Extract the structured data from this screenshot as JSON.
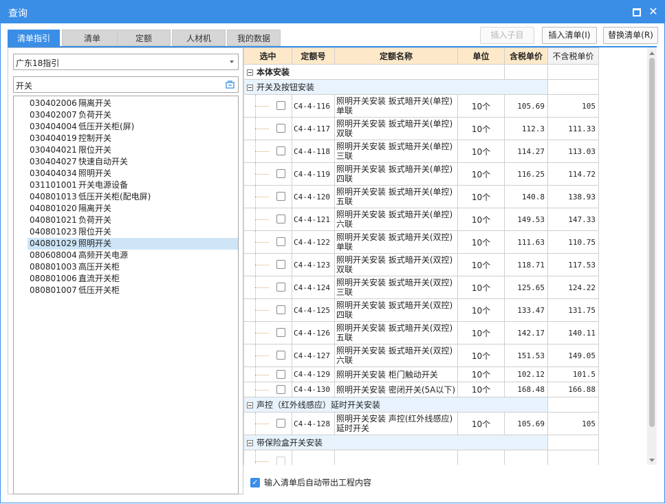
{
  "window": {
    "title": "查询"
  },
  "tabs": [
    {
      "label": "清单指引",
      "active": true
    },
    {
      "label": "清单",
      "active": false
    },
    {
      "label": "定额",
      "active": false
    },
    {
      "label": "人材机",
      "active": false
    },
    {
      "label": "我的数据",
      "active": false
    }
  ],
  "toolbar": {
    "insert_child_label": "插入子目",
    "insert_list_label": "插入清单(I)",
    "replace_list_label": "替换清单(R)"
  },
  "left": {
    "guide_select": "广东18指引",
    "search_value": "开关",
    "items": [
      {
        "code": "030402006",
        "name": "隔离开关"
      },
      {
        "code": "030402007",
        "name": "负荷开关"
      },
      {
        "code": "030404004",
        "name": "低压开关柜(屏)"
      },
      {
        "code": "030404019",
        "name": "控制开关"
      },
      {
        "code": "030404021",
        "name": "限位开关"
      },
      {
        "code": "030404027",
        "name": "快速自动开关"
      },
      {
        "code": "030404034",
        "name": "照明开关"
      },
      {
        "code": "031101001",
        "name": "开关电源设备"
      },
      {
        "code": "040801013",
        "name": "低压开关柜(配电屏)"
      },
      {
        "code": "040801020",
        "name": "隔离开关"
      },
      {
        "code": "040801021",
        "name": "负荷开关"
      },
      {
        "code": "040801023",
        "name": "限位开关"
      },
      {
        "code": "040801029",
        "name": "照明开关",
        "selected": true
      },
      {
        "code": "080608004",
        "name": "高频开关电源"
      },
      {
        "code": "080801003",
        "name": "高压开关柜"
      },
      {
        "code": "080801006",
        "name": "直流开关柜"
      },
      {
        "code": "080801007",
        "name": "低压开关柜"
      }
    ]
  },
  "grid": {
    "headers": [
      "选中",
      "定额号",
      "定额名称",
      "单位",
      "含税单价",
      "不含税单价"
    ],
    "root_group": "本体安装",
    "groups": [
      {
        "title": "开关及按钮安装",
        "rows": [
          {
            "code": "C4-4-116",
            "name": "照明开关安装 扳式暗开关(单控)单联",
            "unit": "10个",
            "price_tax": "105.69",
            "price_notax": "105"
          },
          {
            "code": "C4-4-117",
            "name": "照明开关安装 扳式暗开关(单控)双联",
            "unit": "10个",
            "price_tax": "112.3",
            "price_notax": "111.33"
          },
          {
            "code": "C4-4-118",
            "name": "照明开关安装 扳式暗开关(单控)三联",
            "unit": "10个",
            "price_tax": "114.27",
            "price_notax": "113.03"
          },
          {
            "code": "C4-4-119",
            "name": "照明开关安装 扳式暗开关(单控)四联",
            "unit": "10个",
            "price_tax": "116.25",
            "price_notax": "114.72"
          },
          {
            "code": "C4-4-120",
            "name": "照明开关安装 扳式暗开关(单控)五联",
            "unit": "10个",
            "price_tax": "140.8",
            "price_notax": "138.93"
          },
          {
            "code": "C4-4-121",
            "name": "照明开关安装 扳式暗开关(单控)六联",
            "unit": "10个",
            "price_tax": "149.53",
            "price_notax": "147.33"
          },
          {
            "code": "C4-4-122",
            "name": "照明开关安装 扳式暗开关(双控)单联",
            "unit": "10个",
            "price_tax": "111.63",
            "price_notax": "110.75"
          },
          {
            "code": "C4-4-123",
            "name": "照明开关安装 扳式暗开关(双控)双联",
            "unit": "10个",
            "price_tax": "118.71",
            "price_notax": "117.53"
          },
          {
            "code": "C4-4-124",
            "name": "照明开关安装 扳式暗开关(双控)三联",
            "unit": "10个",
            "price_tax": "125.65",
            "price_notax": "124.22"
          },
          {
            "code": "C4-4-125",
            "name": "照明开关安装 扳式暗开关(双控)四联",
            "unit": "10个",
            "price_tax": "133.47",
            "price_notax": "131.75"
          },
          {
            "code": "C4-4-126",
            "name": "照明开关安装 扳式暗开关(双控)五联",
            "unit": "10个",
            "price_tax": "142.17",
            "price_notax": "140.11"
          },
          {
            "code": "C4-4-127",
            "name": "照明开关安装 扳式暗开关(双控)六联",
            "unit": "10个",
            "price_tax": "151.53",
            "price_notax": "149.05"
          },
          {
            "code": "C4-4-129",
            "name": "照明开关安装 柜门触动开关",
            "unit": "10个",
            "price_tax": "102.12",
            "price_notax": "101.5",
            "short": true
          },
          {
            "code": "C4-4-130",
            "name": "照明开关安装 密闭开关(5A以下)",
            "unit": "10个",
            "price_tax": "168.48",
            "price_notax": "166.88",
            "short": true
          }
        ]
      },
      {
        "title": "声控（红外线感应）延时开关安装",
        "rows": [
          {
            "code": "C4-4-128",
            "name": "照明开关安装 声控(红外线感应)延时开关",
            "unit": "10个",
            "price_tax": "105.69",
            "price_notax": "105"
          }
        ]
      },
      {
        "title": "带保险盒开关安装",
        "rows": [
          {
            "code": "",
            "name": "",
            "unit": "",
            "price_tax": "",
            "price_notax": "",
            "placeholder": true
          }
        ]
      }
    ]
  },
  "footer": {
    "auto_content_label": "输入清单后自动带出工程内容",
    "auto_content_checked": true
  }
}
